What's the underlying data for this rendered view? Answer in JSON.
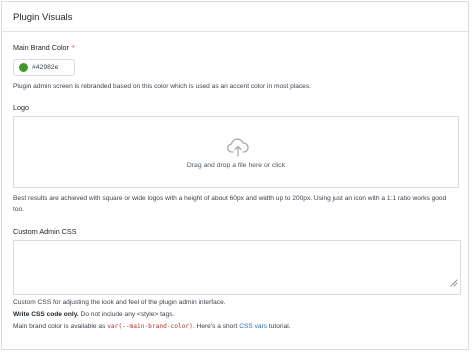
{
  "panel": {
    "title": "Plugin Visuals"
  },
  "brand_color": {
    "label": "Main Brand Color",
    "required_mark": "*",
    "value": "#42982e",
    "swatch_color": "#42982e",
    "help": "Plugin admin screen is rebranded based on this color which is used as an accent color in most places."
  },
  "logo": {
    "label": "Logo",
    "dropzone_icon": "cloud-upload-icon",
    "dropzone_text": "Drag and drop a file here or click",
    "help": "Best results are achieved with square or wide logos with a height of about 60px and width up to 200px. Using just an icon with a 1:1 ratio works good too."
  },
  "custom_css": {
    "label": "Custom Admin CSS",
    "value": "",
    "help_line1": "Custom CSS for adjusting the look and feel of the plugin admin interface.",
    "help_line2_bold": "Write CSS code only.",
    "help_line2_rest": " Do not include any <style> tags.",
    "help_line3_start": "Main brand color is available as ",
    "help_line3_code": "var(--main-brand-color)",
    "help_line3_mid": ". Here's a short ",
    "help_line3_link": "CSS vars",
    "help_line3_end": " tutorial."
  }
}
